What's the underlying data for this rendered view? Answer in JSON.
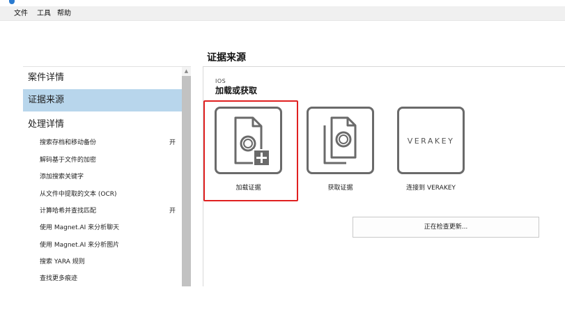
{
  "menubar": {
    "items": [
      {
        "label": "文件"
      },
      {
        "label": "工具"
      },
      {
        "label": "帮助"
      }
    ]
  },
  "page": {
    "title": "证据来源"
  },
  "sidebar": {
    "items": [
      {
        "label": "案件详情",
        "selected": false
      },
      {
        "label": "证据来源",
        "selected": true
      },
      {
        "label": "处理详情",
        "selected": false
      }
    ],
    "sub_items": [
      {
        "label": "搜索存档和移动备份",
        "state": "开"
      },
      {
        "label": "解码基于文件的加密",
        "state": ""
      },
      {
        "label": "添加搜索关键字",
        "state": ""
      },
      {
        "label": "从文件中提取的文本 (OCR)",
        "state": ""
      },
      {
        "label": "计算哈希并查找匹配",
        "state": "开"
      },
      {
        "label": "使用 Magnet.AI 来分析聊天",
        "state": ""
      },
      {
        "label": "使用 Magnet.AI 来分析图片",
        "state": ""
      },
      {
        "label": "搜索 YARA 规则",
        "state": ""
      },
      {
        "label": "查找更多痕迹",
        "state": ""
      }
    ]
  },
  "content": {
    "platform": "IOS",
    "section_title": "加载或获取",
    "tiles": [
      {
        "label": "加载证据",
        "icon": "load-evidence-icon"
      },
      {
        "label": "获取证据",
        "icon": "acquire-evidence-icon"
      },
      {
        "label": "连接到 VERAKEY",
        "icon": "verakey-logo",
        "logo_text": "VERAKEY"
      }
    ],
    "update_button": "正在检查更新..."
  },
  "colors": {
    "selected_nav": "#b8d6ec",
    "highlight": "#e02020",
    "tile_border": "#6a6a6a"
  }
}
